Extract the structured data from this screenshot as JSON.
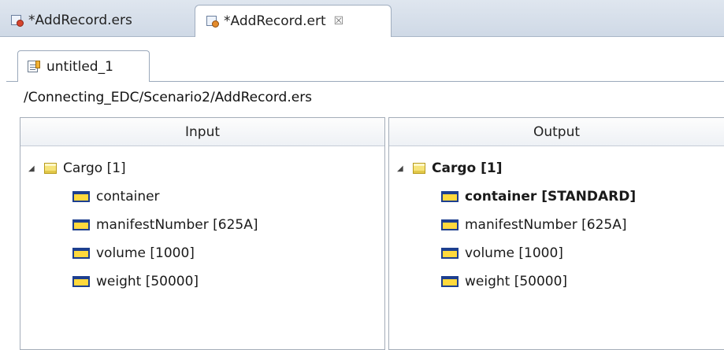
{
  "editor_tabs": [
    {
      "label": "*AddRecord.ers",
      "icon": "ers-file-icon",
      "active": false
    },
    {
      "label": "*AddRecord.ert",
      "icon": "ert-file-icon",
      "active": true,
      "close_glyph": "☒"
    }
  ],
  "inner_tab": {
    "label": "untitled_1",
    "icon": "document-icon"
  },
  "path": "/Connecting_EDC/Scenario2/AddRecord.ers",
  "input": {
    "header": "Input",
    "root": {
      "label": "Cargo [1]",
      "expander": "◢"
    },
    "fields": [
      "container",
      "manifestNumber [625A]",
      "volume [1000]",
      "weight [50000]"
    ]
  },
  "output": {
    "header": "Output",
    "root": {
      "label": "Cargo [1]",
      "expander": "◢"
    },
    "fields": [
      "container [STANDARD]",
      "manifestNumber [625A]",
      "volume [1000]",
      "weight [50000]"
    ]
  },
  "colors": {
    "tab_bar": "#cfd9e6",
    "field_icon_fill": "#ffd93d",
    "field_icon_border": "#1d3f8f",
    "folder_icon_fill": "#f6e47a"
  }
}
